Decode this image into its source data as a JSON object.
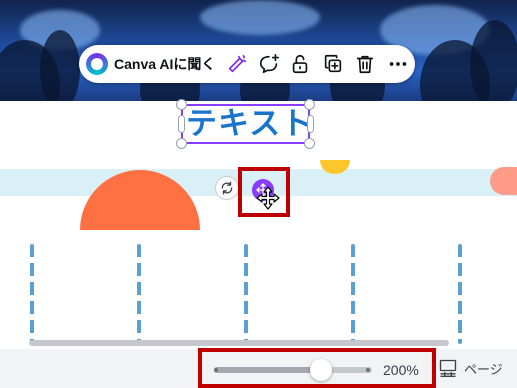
{
  "toolbar": {
    "ai_label": "Canva AIに聞く",
    "icons": [
      "magic-edit-icon",
      "comment-add-icon",
      "unlock-icon",
      "duplicate-icon",
      "trash-icon",
      "more-icon"
    ]
  },
  "canvas": {
    "text_element": "テキスト"
  },
  "zoom": {
    "value_label": "200%",
    "level": 0.68
  },
  "pages": {
    "label": "ページ"
  },
  "colors": {
    "selection": "#8b3dff",
    "text": "#1a74c9",
    "highlight": "#c00000",
    "accent_orange": "#ff7142"
  }
}
